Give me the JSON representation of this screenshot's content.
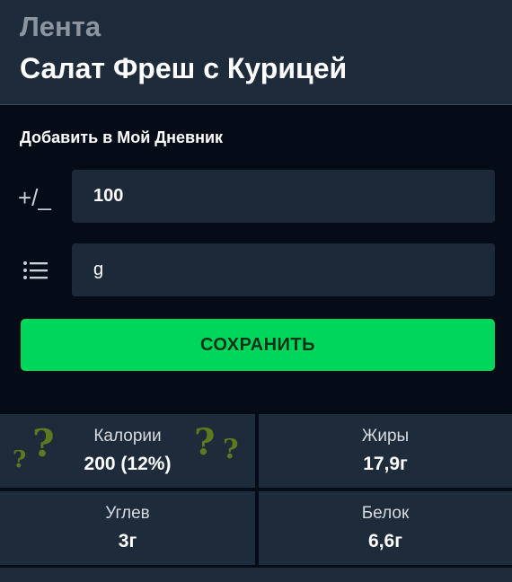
{
  "header": {
    "brand": "Лента",
    "title": "Салат Фреш с Курицей"
  },
  "diary": {
    "add_label": "Добавить в Мой Дневник",
    "quantity_icon": "+/_",
    "quantity_value": "100",
    "unit_icon": "list-icon",
    "unit_value": "g",
    "save_label": "СОХРАНИТЬ"
  },
  "nutrition": {
    "calories": {
      "label": "Калории",
      "value": "200 (12%)"
    },
    "fat": {
      "label": "Жиры",
      "value": "17,9г"
    },
    "carbs": {
      "label": "Углев",
      "value": "3г"
    },
    "protein": {
      "label": "Белок",
      "value": "6,6г"
    },
    "decor": [
      "?",
      "?",
      "?",
      "?"
    ]
  },
  "colors": {
    "accent": "#00d65c",
    "header_bg": "#1d2b3a",
    "page_bg": "#050c18",
    "field_bg": "#1c2938"
  }
}
